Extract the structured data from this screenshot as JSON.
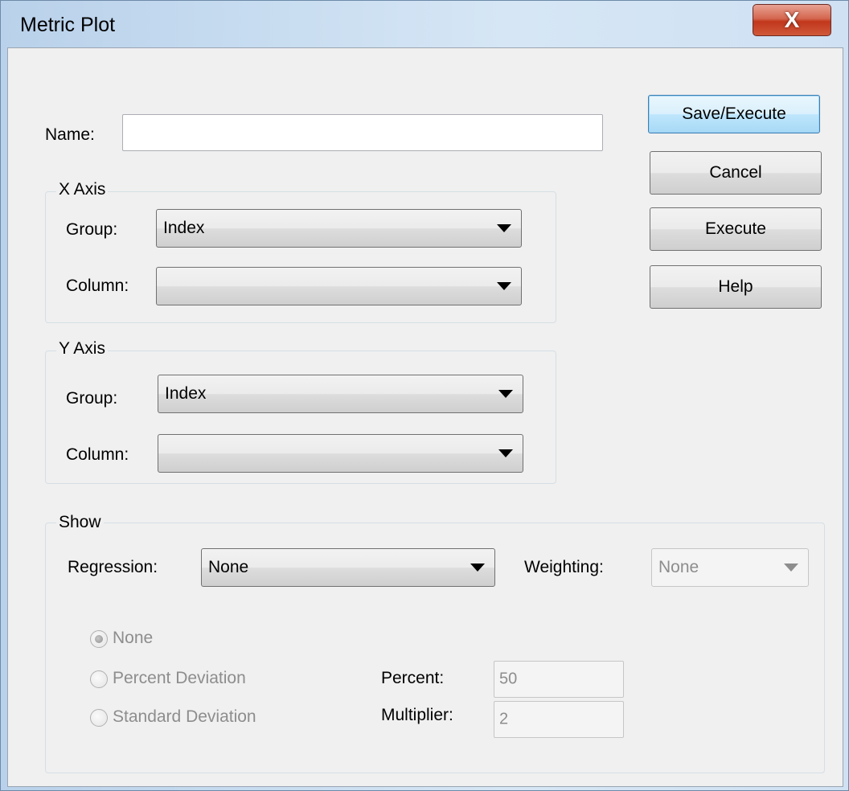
{
  "window": {
    "title": "Metric Plot",
    "close_label": "X"
  },
  "name_field": {
    "label": "Name:",
    "value": ""
  },
  "x_axis": {
    "legend": "X Axis",
    "group_label": "Group:",
    "group_value": "Index",
    "column_label": "Column:",
    "column_value": ""
  },
  "y_axis": {
    "legend": "Y Axis",
    "group_label": "Group:",
    "group_value": "Index",
    "column_label": "Column:",
    "column_value": ""
  },
  "show": {
    "legend": "Show",
    "regression_label": "Regression:",
    "regression_value": "None",
    "weighting_label": "Weighting:",
    "weighting_value": "None",
    "radios": [
      {
        "label": "None",
        "checked": true
      },
      {
        "label": "Percent Deviation",
        "checked": false
      },
      {
        "label": "Standard Deviation",
        "checked": false
      }
    ],
    "percent_label": "Percent:",
    "percent_value": "50",
    "multiplier_label": "Multiplier:",
    "multiplier_value": "2"
  },
  "buttons": {
    "save_execute": "Save/Execute",
    "cancel": "Cancel",
    "execute": "Execute",
    "help": "Help"
  }
}
